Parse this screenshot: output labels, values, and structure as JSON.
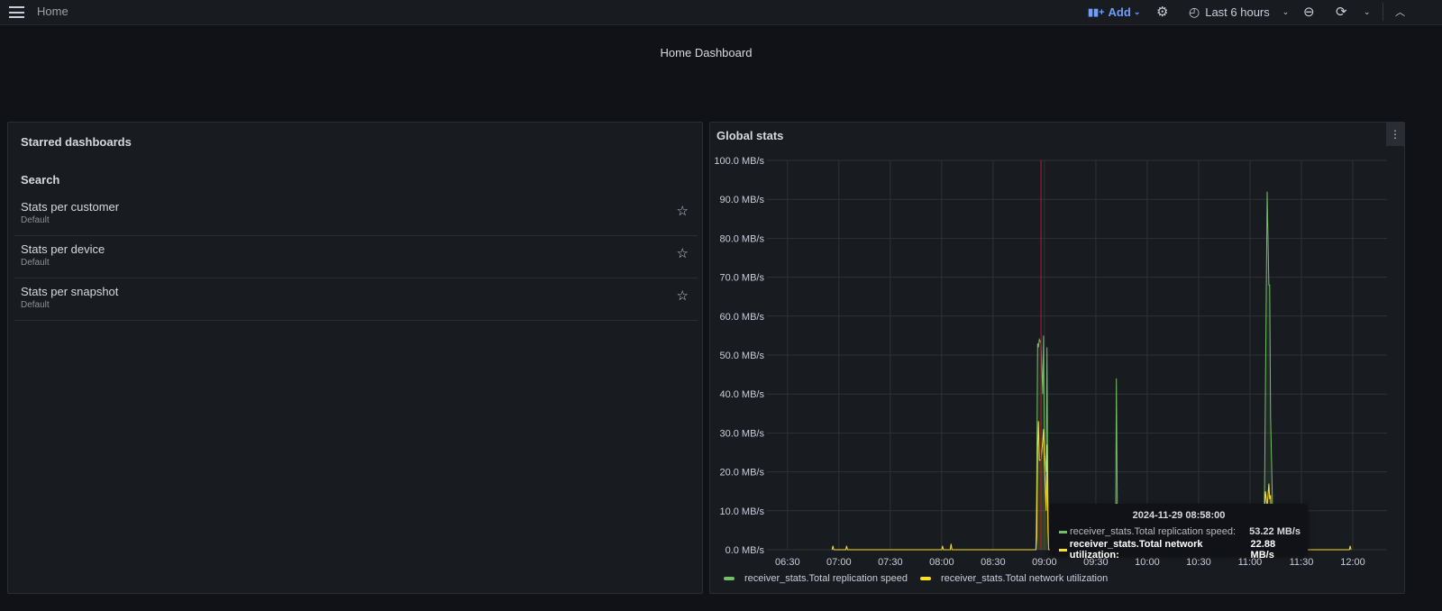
{
  "topbar": {
    "breadcrumb": "Home",
    "add_label": "Add",
    "time_range": "Last 6 hours",
    "icons": [
      "menu-icon",
      "chart-add-icon",
      "gear-icon",
      "clock-icon",
      "zoom-out-icon",
      "refresh-icon",
      "chevron-up-icon"
    ]
  },
  "dashboard": {
    "title": "Home Dashboard"
  },
  "starred": {
    "title": "Starred dashboards",
    "search_heading": "Search",
    "items": [
      {
        "name": "Stats per customer",
        "folder": "Default"
      },
      {
        "name": "Stats per device",
        "folder": "Default"
      },
      {
        "name": "Stats per snapshot",
        "folder": "Default"
      }
    ]
  },
  "global_stats": {
    "title": "Global stats",
    "tooltip": {
      "time": "2024-11-29 08:58:00",
      "rows": [
        {
          "label": "receiver_stats.Total replication speed:",
          "value": "53.22 MB/s"
        },
        {
          "label": "receiver_stats.Total network utilization:",
          "value": "22.88 MB/s"
        }
      ]
    }
  },
  "chart_data": {
    "type": "line",
    "xlabel": "",
    "ylabel": "",
    "x_range": [
      "06:18",
      "12:20"
    ],
    "ylim": [
      0,
      100
    ],
    "grid": true,
    "legend": "bottom-left",
    "hover_time": "08:58",
    "x_ticks": [
      "06:30",
      "07:00",
      "07:30",
      "08:00",
      "08:30",
      "09:00",
      "09:30",
      "10:00",
      "10:30",
      "11:00",
      "11:30",
      "12:00"
    ],
    "y_ticks": [
      "0.0 MB/s",
      "10.0 MB/s",
      "20.0 MB/s",
      "30.0 MB/s",
      "40.0 MB/s",
      "50.0 MB/s",
      "60.0 MB/s",
      "70.0 MB/s",
      "80.0 MB/s",
      "90.0 MB/s",
      "100.0 MB/s"
    ],
    "y_tick_values": [
      0,
      10,
      20,
      30,
      40,
      50,
      60,
      70,
      80,
      90,
      100
    ],
    "series": [
      {
        "name": "receiver_stats.Total replication speed",
        "color": "#73bf69",
        "points": [
          [
            "08:55",
            0
          ],
          [
            "08:55.5",
            17
          ],
          [
            "08:56",
            53
          ],
          [
            "08:56.5",
            52
          ],
          [
            "08:57",
            54
          ],
          [
            "08:58",
            53
          ],
          [
            "08:59",
            40
          ],
          [
            "08:59.5",
            55
          ],
          [
            "09:00",
            25
          ],
          [
            "09:01",
            20
          ],
          [
            "09:01.5",
            52
          ],
          [
            "09:02",
            14
          ],
          [
            "09:02.5",
            0
          ],
          [
            "09:41.5",
            0
          ],
          [
            "09:42",
            44
          ],
          [
            "09:42.5",
            12
          ],
          [
            "09:43",
            0
          ],
          [
            "11:08",
            0
          ],
          [
            "11:08.5",
            15
          ],
          [
            "11:10",
            92
          ],
          [
            "11:11",
            68
          ],
          [
            "11:11.5",
            68
          ],
          [
            "11:12",
            34
          ],
          [
            "11:13",
            14
          ],
          [
            "11:13.5",
            0
          ]
        ]
      },
      {
        "name": "receiver_stats.Total network utilization",
        "color": "#fade2a",
        "points": [
          [
            "06:56",
            0
          ],
          [
            "06:56.5",
            1
          ],
          [
            "06:57",
            0
          ],
          [
            "07:04",
            0
          ],
          [
            "07:04.5",
            1
          ],
          [
            "07:05",
            0
          ],
          [
            "08:00",
            0
          ],
          [
            "08:00.5",
            1
          ],
          [
            "08:01",
            0
          ],
          [
            "08:05",
            0
          ],
          [
            "08:05.5",
            1.5
          ],
          [
            "08:06",
            0
          ],
          [
            "08:55",
            0
          ],
          [
            "08:55.5",
            3
          ],
          [
            "08:56",
            26
          ],
          [
            "08:56.5",
            33
          ],
          [
            "08:57",
            23
          ],
          [
            "08:58",
            23
          ],
          [
            "08:59",
            28
          ],
          [
            "08:59.5",
            31
          ],
          [
            "09:00",
            22
          ],
          [
            "09:01",
            10
          ],
          [
            "09:01.5",
            27
          ],
          [
            "09:02",
            5
          ],
          [
            "09:02.5",
            0
          ],
          [
            "09:41.5",
            0
          ],
          [
            "09:42",
            12
          ],
          [
            "09:42.5",
            0
          ],
          [
            "11:08",
            0
          ],
          [
            "11:08.5",
            10
          ],
          [
            "11:09",
            15
          ],
          [
            "11:10",
            11
          ],
          [
            "11:11",
            17
          ],
          [
            "11:11.5",
            13
          ],
          [
            "11:12",
            14
          ],
          [
            "11:13",
            0
          ],
          [
            "11:58",
            0
          ],
          [
            "11:58.5",
            1
          ],
          [
            "11:59",
            0
          ]
        ]
      }
    ]
  }
}
